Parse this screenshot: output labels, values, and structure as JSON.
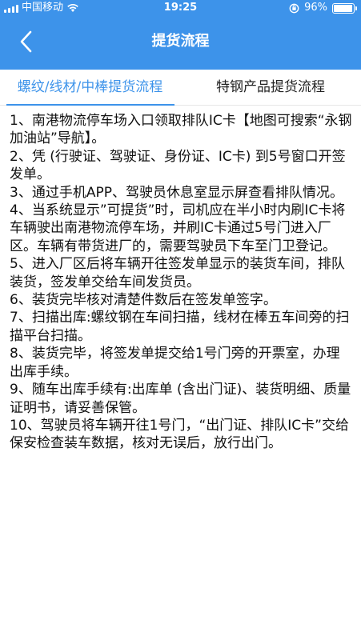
{
  "status_bar": {
    "carrier": "中国移动",
    "time": "19:25",
    "battery": "96%",
    "battery_level": 0.96
  },
  "navbar": {
    "title": "提货流程",
    "back_icon": "chevron-left-icon"
  },
  "tabs": [
    {
      "label": "螺纹/线材/中棒提货流程",
      "active": true
    },
    {
      "label": "特钢产品提货流程",
      "active": false
    }
  ],
  "steps": [
    "1、南港物流停车场入口领取排队IC卡【地图可搜索“永钢加油站”导航】。",
    "2、凭 (行驶证、驾驶证、身份证、IC卡) 到5号窗口开签发单。",
    "3、通过手机APP、驾驶员休息室显示屏查看排队情况。",
    "4、当系统显示”可提货”时，司机应在半小时内刷IC卡将车辆驶出南港物流停车场，并刷IC卡通过5号门进入厂区。车辆有带货进厂的，需要驾驶员下车至门卫登记。",
    "5、进入厂区后将车辆开往签发单显示的装货车间，排队装货，签发单交给车间发货员。",
    "6、装货完毕核对清楚件数后在签发单签字。",
    "7、扫描出库:螺纹钢在车间扫描，线材在棒五车间旁的扫描平台扫描。",
    "8、装货完毕，将签发单提交给1号门旁的开票室，办理出库手续。",
    "9、随车出库手续有:出库单 (含出门证)、装货明细、质量证明书，请妥善保管。",
    "10、驾驶员将车辆开往1号门，“出门证、排队IC卡”交给保安检查装车数据，核对无误后，放行出门。"
  ],
  "colors": {
    "accent": "#3d93ea",
    "header_bg": "#3d93ea"
  }
}
